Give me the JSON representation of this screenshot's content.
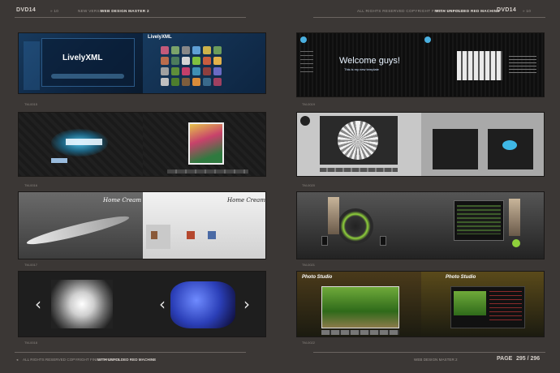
{
  "header": {
    "left_dvd": "DVD14",
    "left_breadcrumb": "WEB DESIGN MASTER 2",
    "left_prefix": "NEW VERSE",
    "right_notice": "ALL RIGHTS RESERVED COPYRIGHT FINELY PRINTED",
    "right_highlight": "WITH UNFOLDED RED MACHINE",
    "right_dvd": "DVD14"
  },
  "footer": {
    "left_notice": "ALL RIGHTS RESERVED COPYRIGHT FINELY PRINTED",
    "left_highlight": "WITH UNFOLDED RED MACHINE",
    "right_title": "WEB DESIGN MASTER 2",
    "page_label": "PAGE",
    "page_numbers": "295 / 296"
  },
  "captions": {
    "p1": "TM-0015",
    "p2": "TM-0016",
    "p3": "TM-0017",
    "p4": "TM-0018",
    "p5": "TM-0019",
    "p6": "TM-0020",
    "p7": "TM-0021",
    "p8": "TM-0022"
  },
  "thumbs": {
    "lively_title": "LivelyXML",
    "lively_title2": "LivelyXML",
    "welcome_title": "Welcome guys!",
    "welcome_sub": "This is my new template",
    "photo_studio1": "Photo Studio",
    "photo_studio2": "Photo Studio",
    "script_title1": "Home Cream",
    "script_title2": "Home Cream"
  },
  "colors": {
    "page_bg": "#3b3735",
    "rule": "#6a6460"
  }
}
